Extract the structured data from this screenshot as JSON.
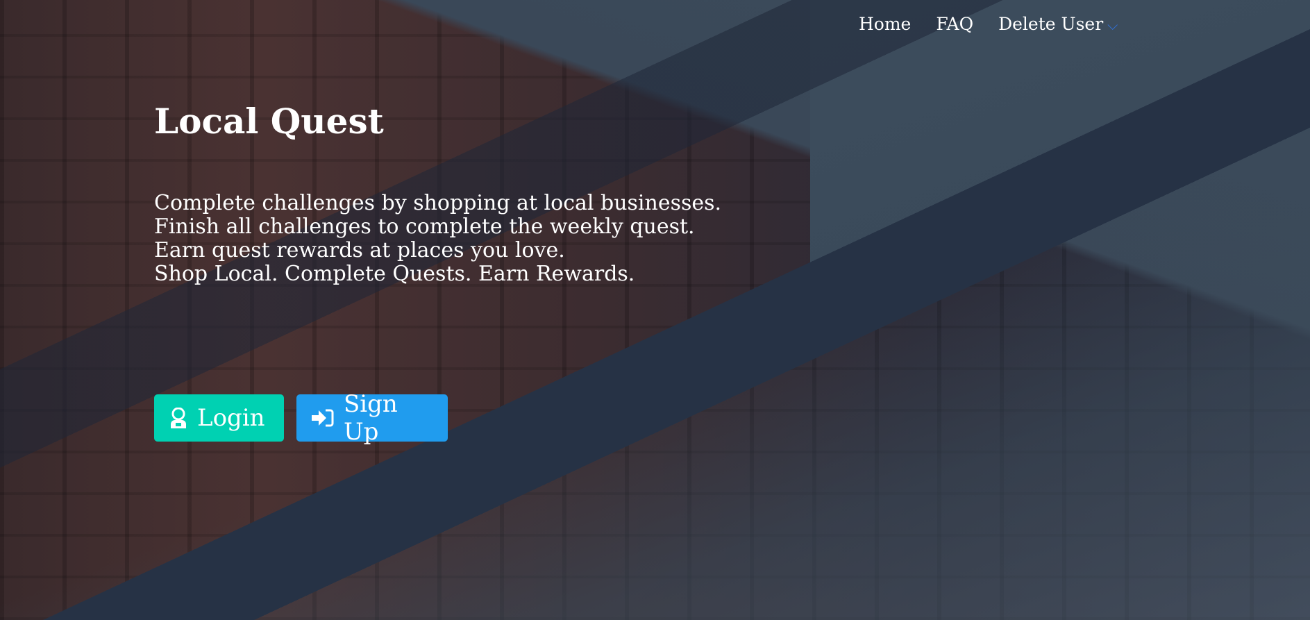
{
  "nav": {
    "items": [
      {
        "label": "Home"
      },
      {
        "label": "FAQ"
      },
      {
        "label": "Delete User"
      }
    ]
  },
  "hero": {
    "title": "Local Quest",
    "lines": [
      "Complete challenges by shopping at local businesses.",
      "Finish all challenges to complete the weekly quest.",
      "Earn quest rewards at places you love.",
      "Shop Local. Complete Quests. Earn Rewards."
    ]
  },
  "buttons": {
    "login": "Login",
    "signup": "Sign Up"
  },
  "colors": {
    "login": "#00d1b2",
    "signup": "#209cee",
    "chevron": "#3273dc"
  }
}
